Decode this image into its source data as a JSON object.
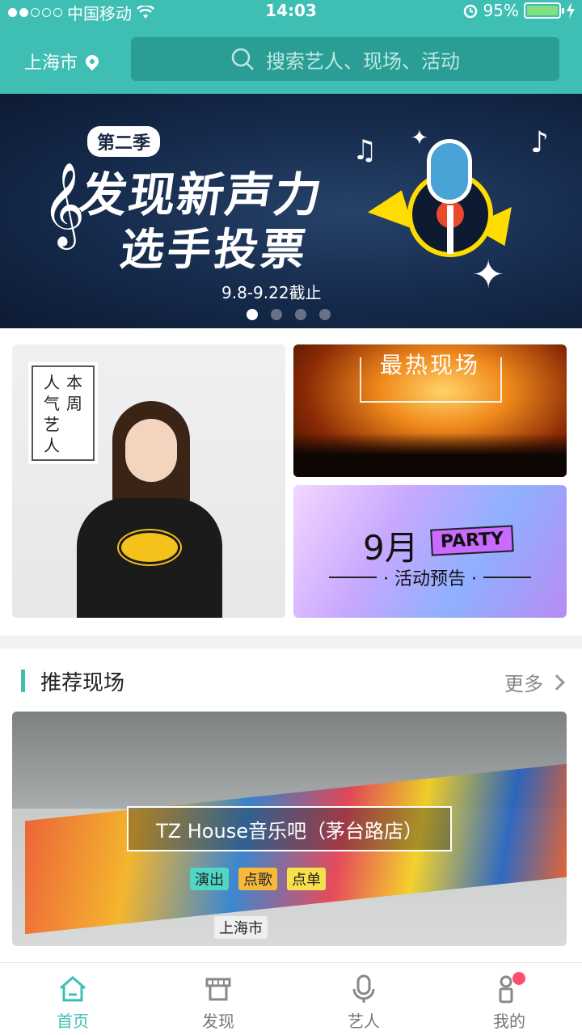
{
  "status": {
    "carrier": "中国移动",
    "time": "14:03",
    "battery": "95%"
  },
  "header": {
    "city": "上海市",
    "search_placeholder": "搜索艺人、现场、活动"
  },
  "banner": {
    "season": "第二季",
    "title_line1": "发现新声力",
    "title_line2": "选手投票",
    "deadline": "9.8-9.22截止",
    "page_count": 4,
    "active_page": 1
  },
  "tiles": {
    "artist_label_col1": "本周",
    "artist_label_col2": "人气艺人",
    "hot_label": "最热现场",
    "party_month": "9月",
    "party_tag": "PARTY",
    "party_sub": "· 活动预告 ·"
  },
  "section": {
    "title": "推荐现场",
    "more": "更多"
  },
  "venue": {
    "name": "TZ House音乐吧（茅台路店）",
    "tags": [
      "上海市",
      "演出",
      "点歌",
      "点单"
    ]
  },
  "tabbar": {
    "items": [
      "首页",
      "发现",
      "艺人",
      "我的"
    ],
    "active": 0
  },
  "colors": {
    "accent": "#3fbfb3",
    "tag_show": "#4fd6c4",
    "tag_song": "#f6b93b",
    "tag_order": "#f7e04a",
    "badge": "#ff4d6d"
  }
}
